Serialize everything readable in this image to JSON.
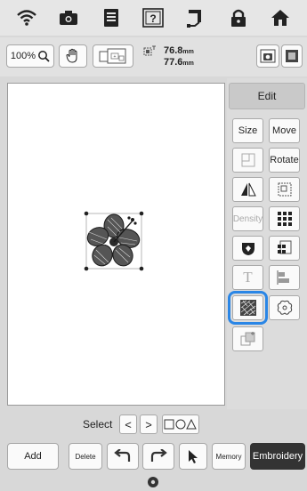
{
  "toolbar": {
    "zoom_label": "100%",
    "width_value": "76.8",
    "height_value": "77.6",
    "unit": "mm"
  },
  "panel": {
    "edit_tab": "Edit",
    "size_label": "Size",
    "move_label": "Move",
    "rotate_label": "Rotate",
    "density_label": "Density",
    "text_glyph": "T"
  },
  "select": {
    "label": "Select",
    "prev": "<",
    "next": ">"
  },
  "bottom": {
    "add_label": "Add",
    "delete_label": "Delete",
    "memory_label": "Memory",
    "embroidery_label": "Embroidery"
  },
  "icons": [
    "wifi-icon",
    "camera-icon",
    "document-icon",
    "help-icon",
    "thread-icon",
    "lock-icon",
    "home-icon"
  ],
  "colors": {
    "selection": "#2a86e6",
    "primary_button": "#333333"
  }
}
